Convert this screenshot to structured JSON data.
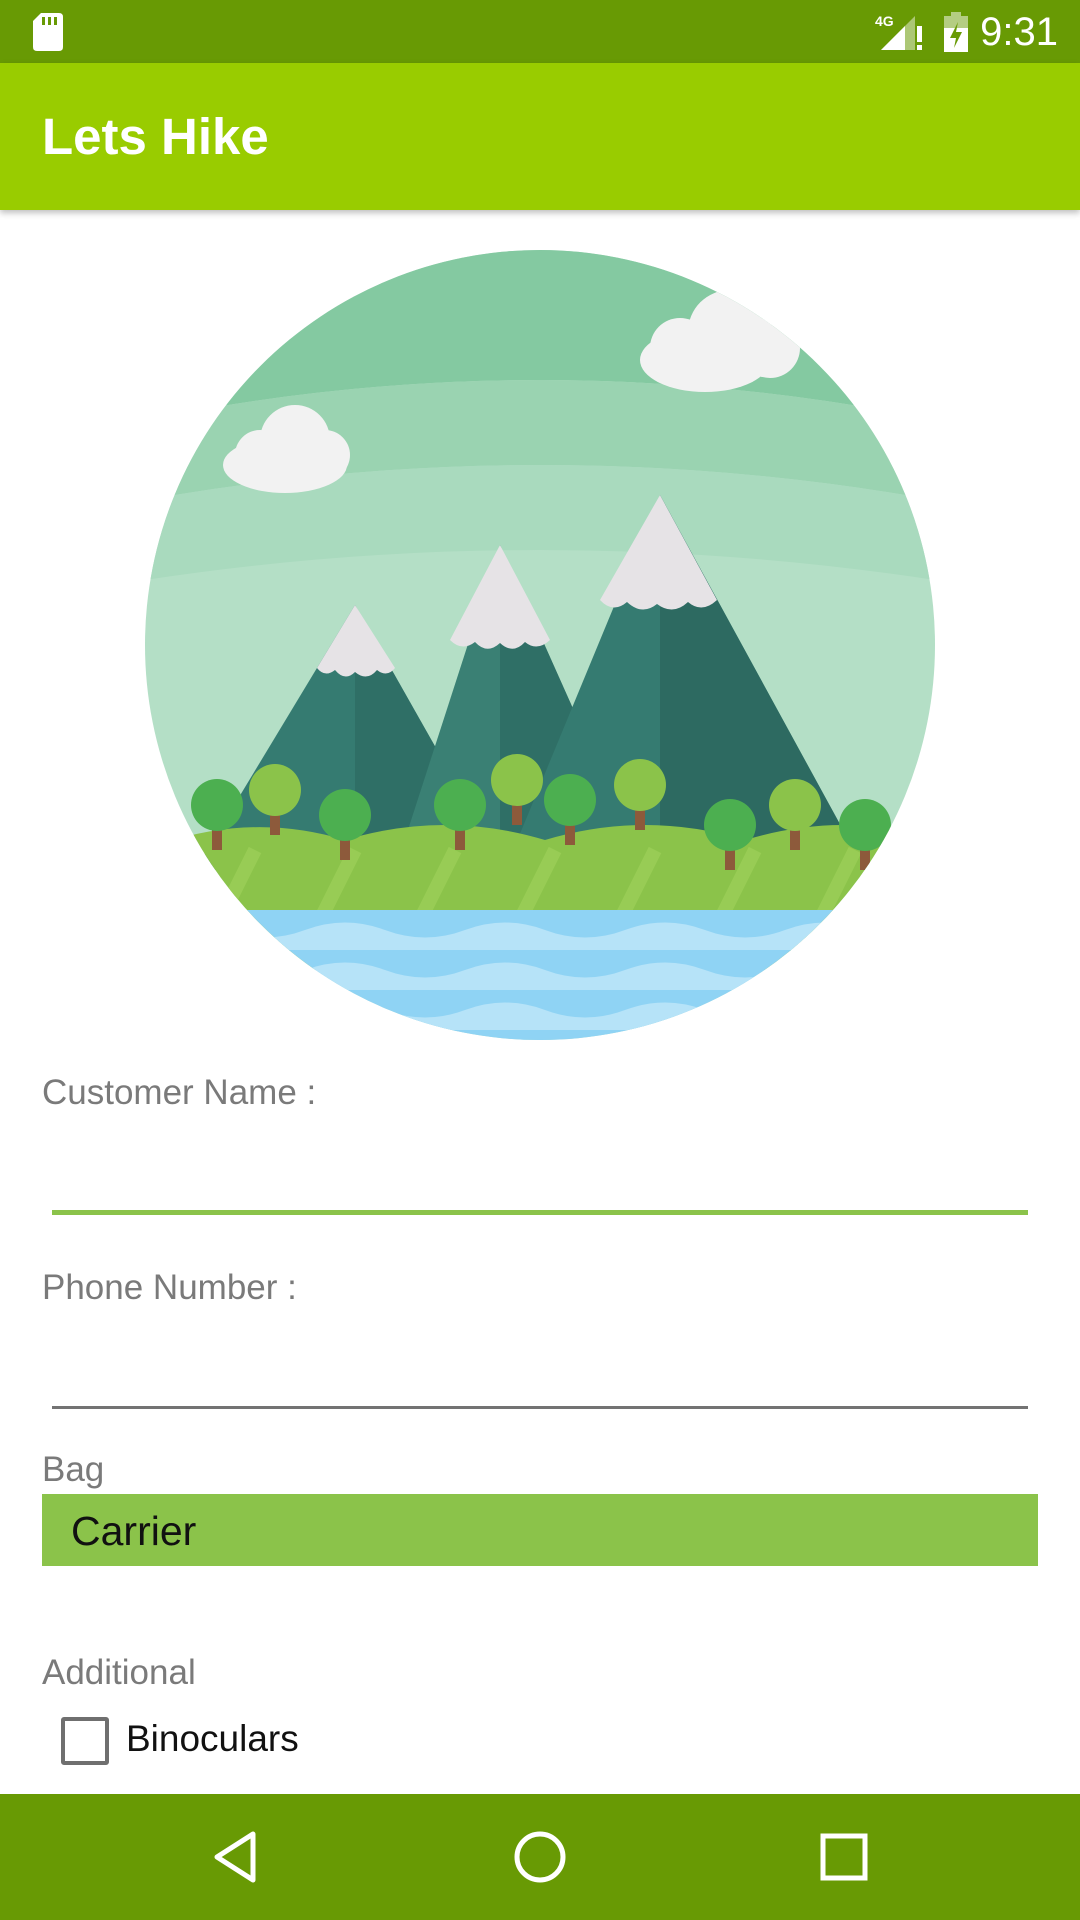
{
  "status_bar": {
    "time": "9:31",
    "network_label": "4G",
    "icons": [
      "sd-card-icon",
      "signal-icon",
      "battery-charging-icon"
    ]
  },
  "app_bar": {
    "title": "Lets Hike"
  },
  "hero_image": {
    "icon": "mountain-landscape-illustration"
  },
  "form": {
    "customer_name": {
      "label": "Customer Name :",
      "value": "",
      "focused": true
    },
    "phone_number": {
      "label": "Phone Number :",
      "value": ""
    },
    "bag": {
      "label": "Bag",
      "selected": "Carrier"
    },
    "additional": {
      "label": "Additional",
      "options": [
        {
          "label": "Binoculars",
          "checked": false
        }
      ]
    }
  },
  "nav_bar": {
    "icons": [
      "back-icon",
      "home-icon",
      "recents-icon"
    ]
  },
  "colors": {
    "status_bar": "#689a04",
    "app_bar": "#99cc00",
    "accent": "#8bc34a",
    "nav_bar": "#689a04"
  }
}
